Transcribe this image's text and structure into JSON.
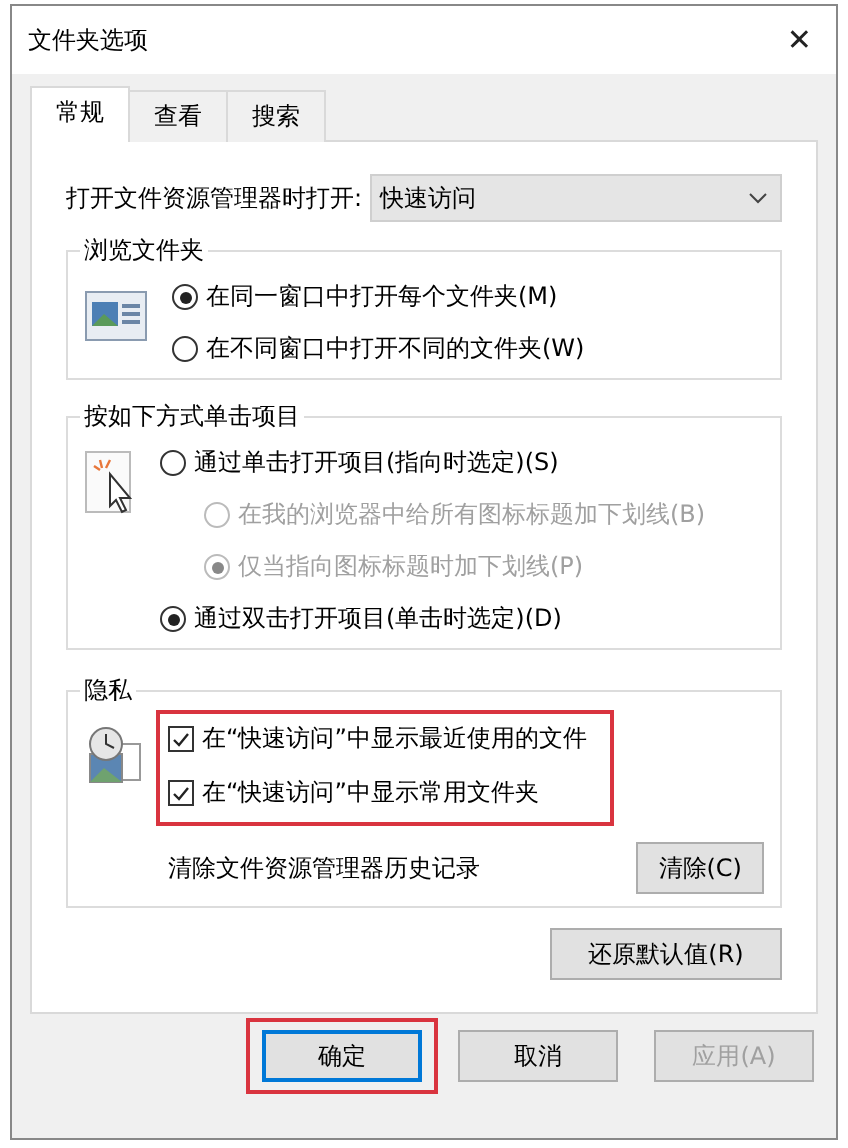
{
  "window": {
    "title": "文件夹选项",
    "close": "✕"
  },
  "tabs": [
    {
      "label": "常规",
      "selected": true
    },
    {
      "label": "查看",
      "selected": false
    },
    {
      "label": "搜索",
      "selected": false
    }
  ],
  "open_explorer": {
    "label": "打开文件资源管理器时打开:",
    "value": "快速访问"
  },
  "browse_folders": {
    "title": "浏览文件夹",
    "options": [
      {
        "label": "在同一窗口中打开每个文件夹(M)",
        "selected": true,
        "disabled": false,
        "indented": false
      },
      {
        "label": "在不同窗口中打开不同的文件夹(W)",
        "selected": false,
        "disabled": false,
        "indented": false
      }
    ]
  },
  "click_items": {
    "title": "按如下方式单击项目",
    "options": [
      {
        "label": "通过单击打开项目(指向时选定)(S)",
        "selected": false,
        "disabled": false,
        "indented": false
      },
      {
        "label": "在我的浏览器中给所有图标标题加下划线(B)",
        "selected": false,
        "disabled": true,
        "indented": true
      },
      {
        "label": "仅当指向图标标题时加下划线(P)",
        "selected": true,
        "disabled": true,
        "indented": true
      },
      {
        "label": "通过双击打开项目(单击时选定)(D)",
        "selected": true,
        "disabled": false,
        "indented": false
      }
    ]
  },
  "privacy": {
    "title": "隐私",
    "highlighted": true,
    "checkboxes": [
      {
        "label": "在“快速访问”中显示最近使用的文件",
        "checked": true
      },
      {
        "label": "在“快速访问”中显示常用文件夹",
        "checked": true
      }
    ],
    "clear_label": "清除文件资源管理器历史记录",
    "clear_button": "清除(C)"
  },
  "restore_button": "还原默认值(R)",
  "buttons": [
    {
      "label": "确定",
      "default": true,
      "highlighted": true,
      "disabled": false
    },
    {
      "label": "取消",
      "default": false,
      "highlighted": false,
      "disabled": false
    },
    {
      "label": "应用(A)",
      "default": false,
      "highlighted": false,
      "disabled": true
    }
  ]
}
